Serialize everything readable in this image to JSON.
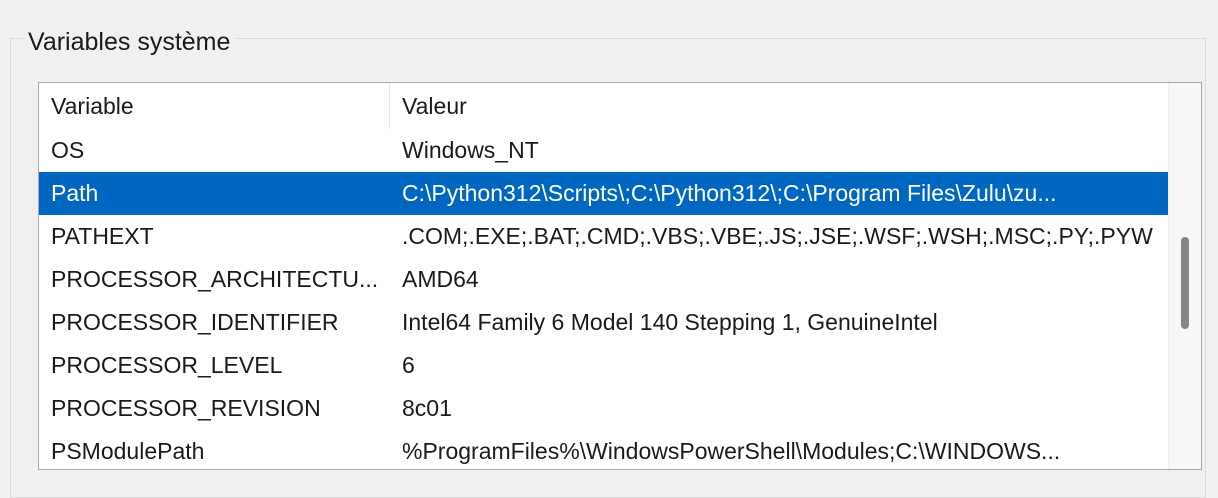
{
  "group": {
    "title": "Variables système"
  },
  "table": {
    "columns": [
      "Variable",
      "Valeur"
    ],
    "rows": [
      {
        "variable": "OS",
        "value": "Windows_NT",
        "selected": false
      },
      {
        "variable": "Path",
        "value": "C:\\Python312\\Scripts\\;C:\\Python312\\;C:\\Program Files\\Zulu\\zu...",
        "selected": true
      },
      {
        "variable": "PATHEXT",
        "value": ".COM;.EXE;.BAT;.CMD;.VBS;.VBE;.JS;.JSE;.WSF;.WSH;.MSC;.PY;.PYW",
        "selected": false
      },
      {
        "variable": "PROCESSOR_ARCHITECTU...",
        "value": "AMD64",
        "selected": false
      },
      {
        "variable": "PROCESSOR_IDENTIFIER",
        "value": "Intel64 Family 6 Model 140 Stepping 1, GenuineIntel",
        "selected": false
      },
      {
        "variable": "PROCESSOR_LEVEL",
        "value": "6",
        "selected": false
      },
      {
        "variable": "PROCESSOR_REVISION",
        "value": "8c01",
        "selected": false
      },
      {
        "variable": "PSModulePath",
        "value": "%ProgramFiles%\\WindowsPowerShell\\Modules;C:\\WINDOWS...",
        "selected": false
      }
    ]
  },
  "colors": {
    "selection": "#0067c0",
    "scrollbar_thumb": "#858585"
  }
}
